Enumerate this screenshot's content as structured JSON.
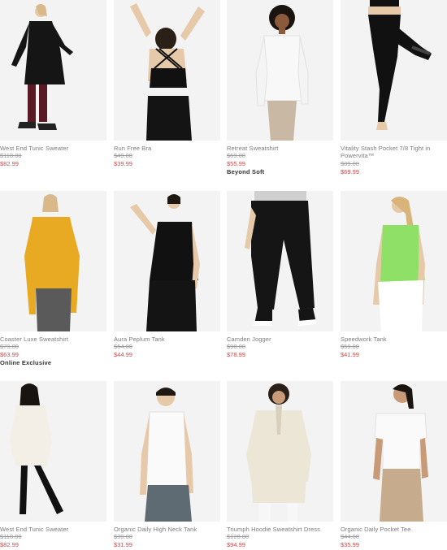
{
  "products": [
    {
      "name": "West End Tunic Sweater",
      "original_price": "$118.00",
      "sale_price": "$82.99",
      "badge": "",
      "image": "model-black-tunic-sweater"
    },
    {
      "name": "Run Free Bra",
      "original_price": "$49.00",
      "sale_price": "$39.99",
      "badge": "",
      "image": "model-black-sports-bra"
    },
    {
      "name": "Retreat Sweatshirt",
      "original_price": "$69.00",
      "sale_price": "$55.99",
      "badge": "Beyond Soft",
      "image": "model-white-sweatshirt"
    },
    {
      "name": "Vitality Stash Pocket 7/8 Tight in Powervita™",
      "original_price": "$89.00",
      "sale_price": "$69.99",
      "badge": "",
      "image": "model-black-tights"
    },
    {
      "name": "Coaster Luxe Sweatshirt",
      "original_price": "$79.00",
      "sale_price": "$63.99",
      "badge": "Online Exclusive",
      "image": "model-yellow-sweatshirt"
    },
    {
      "name": "Aura Peplum Tank",
      "original_price": "$64.00",
      "sale_price": "$44.99",
      "badge": "",
      "image": "model-black-tank"
    },
    {
      "name": "Camden Jogger",
      "original_price": "$98.00",
      "sale_price": "$78.99",
      "badge": "",
      "image": "model-black-jogger"
    },
    {
      "name": "Speedwork Tank",
      "original_price": "$59.00",
      "sale_price": "$41.99",
      "badge": "",
      "image": "model-green-tank"
    },
    {
      "name": "West End Tunic Sweater",
      "original_price": "$118.00",
      "sale_price": "$82.99",
      "badge": "",
      "image": "model-white-tunic-sweater"
    },
    {
      "name": "Organic Daily High Neck Tank",
      "original_price": "$39.00",
      "sale_price": "$31.99",
      "badge": "",
      "image": "model-white-tank"
    },
    {
      "name": "Triumph Hoodie Sweatshirt Dress",
      "original_price": "$128.00",
      "sale_price": "$94.99",
      "badge": "",
      "image": "model-cream-hoodie-dress"
    },
    {
      "name": "Organic Daily Pocket Tee",
      "original_price": "$44.00",
      "sale_price": "$35.99",
      "badge": "",
      "image": "model-white-tee"
    }
  ],
  "colors": {
    "photo_bg": "#f1f1f1",
    "name_text": "#7a7a7a",
    "original_price": "#9a9a9a",
    "sale_price": "#c84a4a",
    "badge_text": "#333333"
  }
}
